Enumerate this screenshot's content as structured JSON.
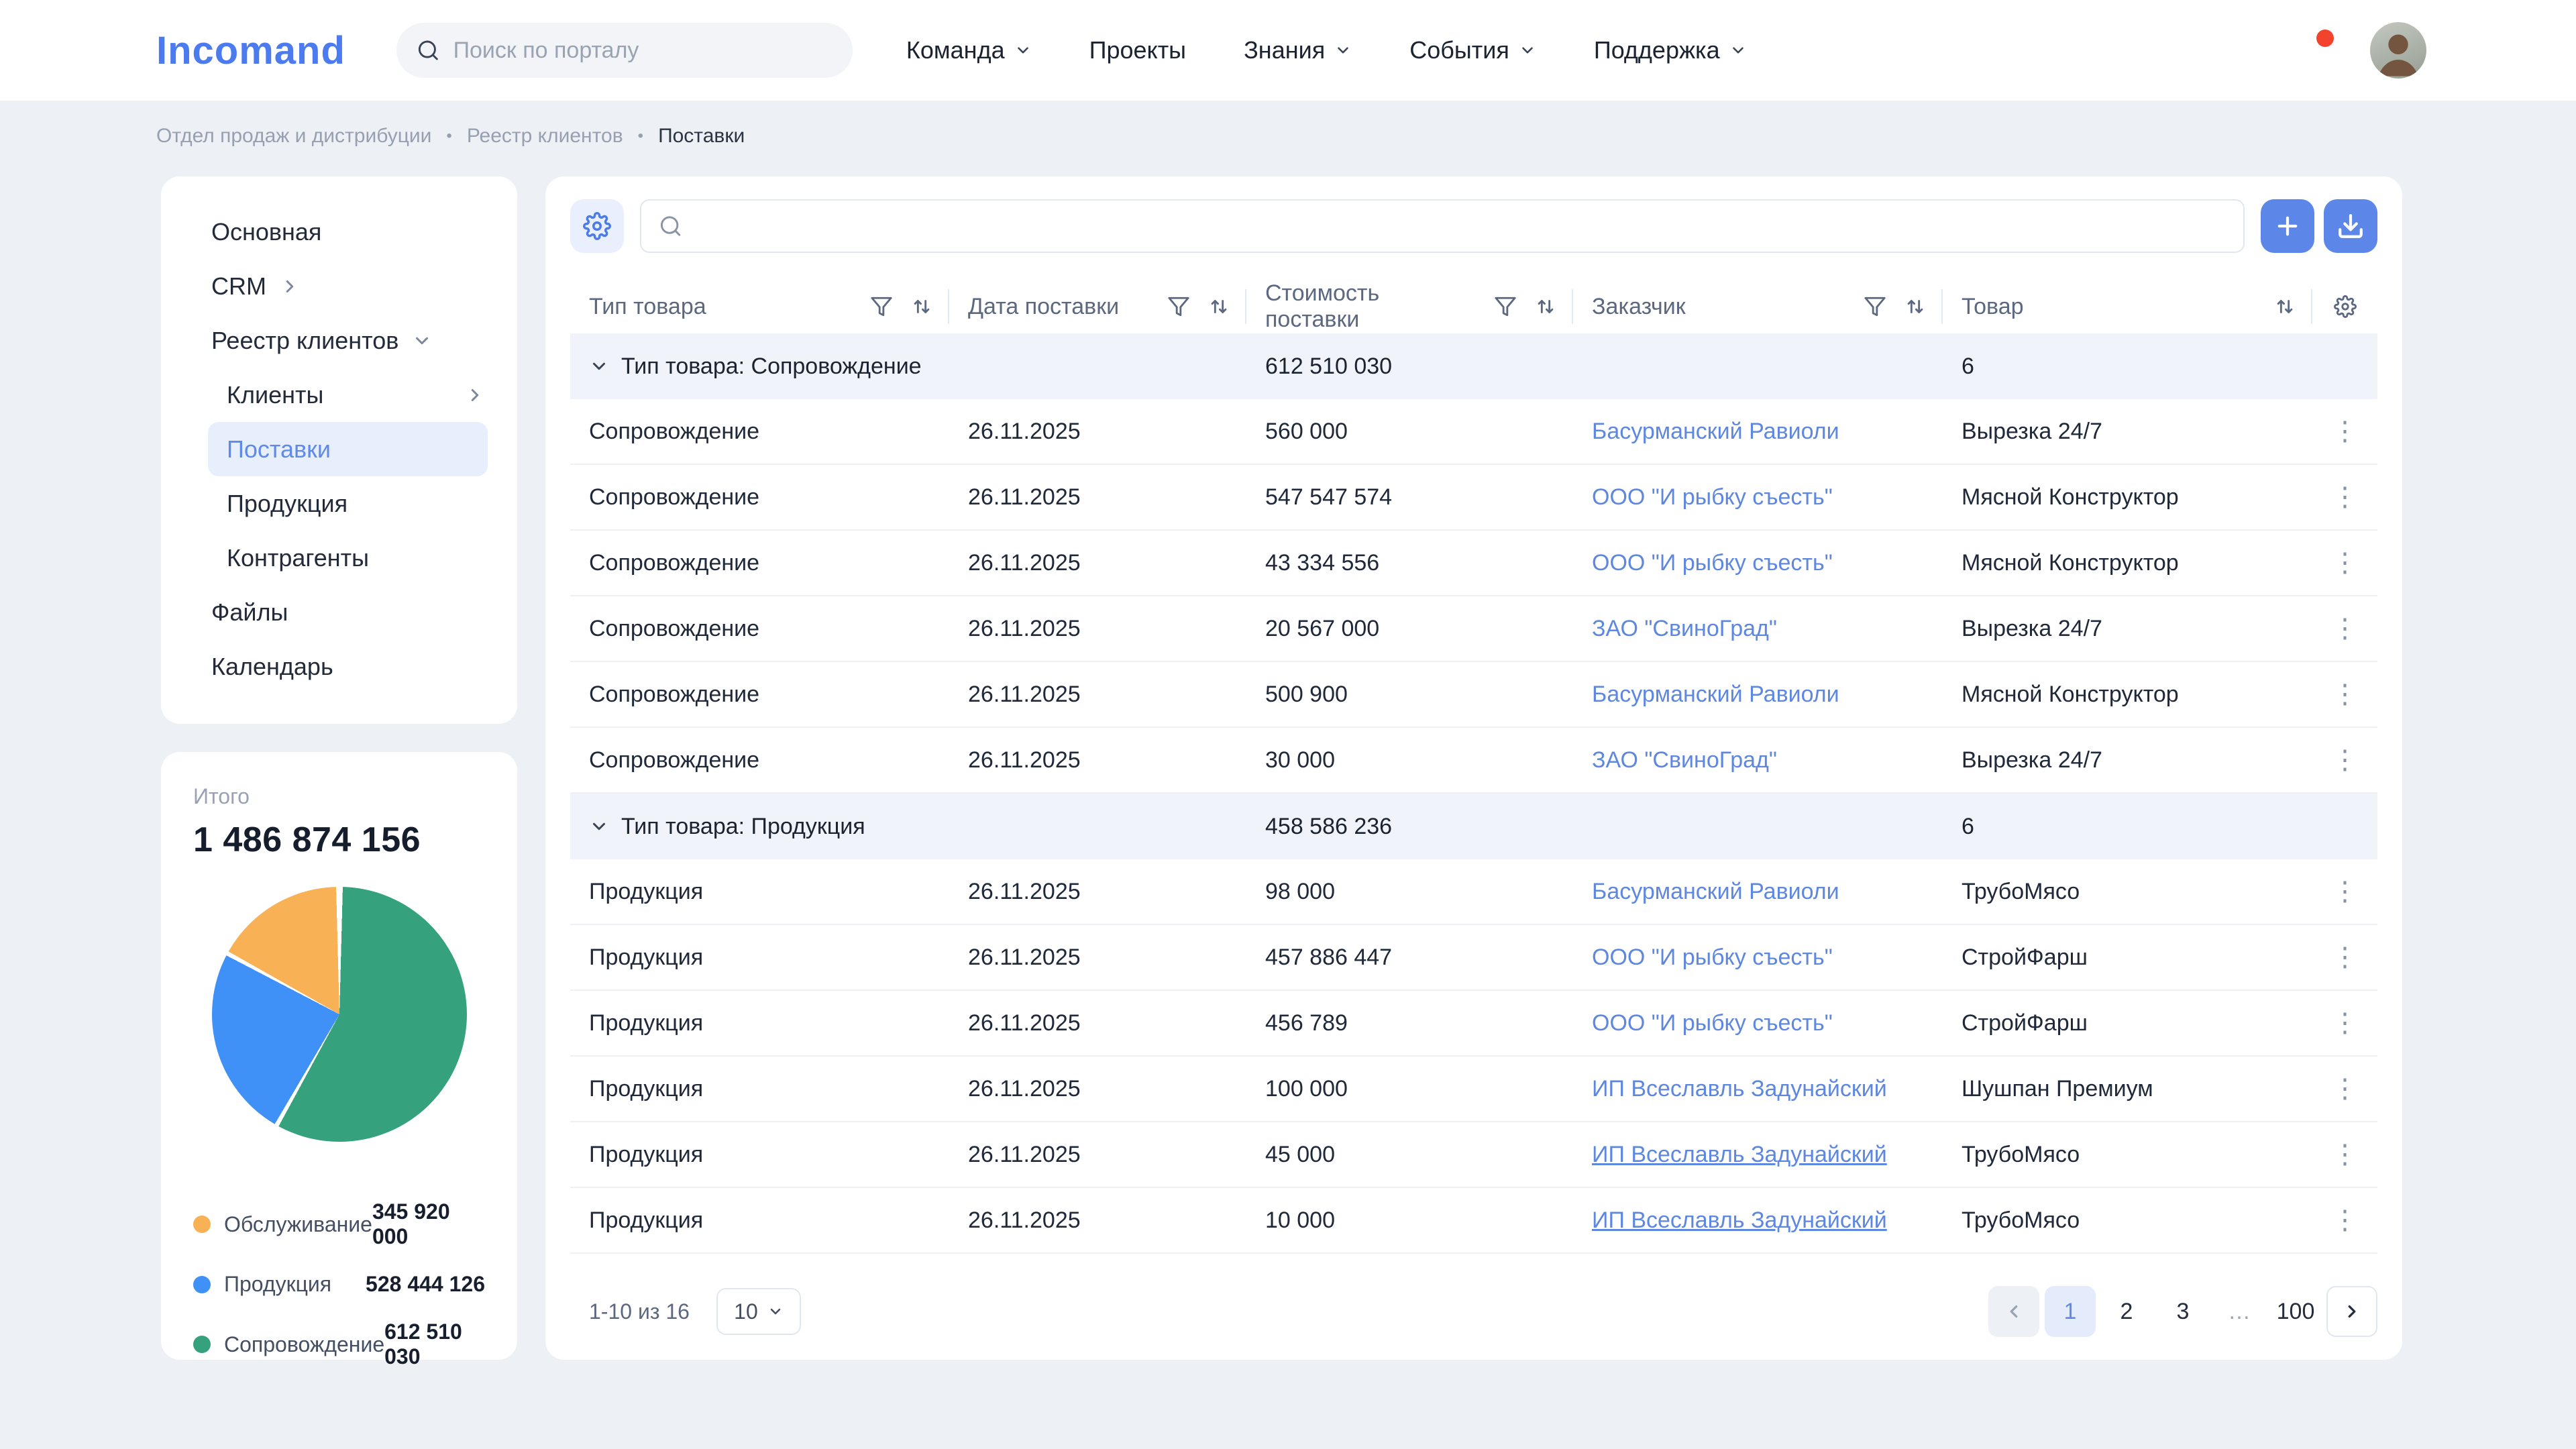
{
  "header": {
    "logo": "Incomand",
    "search_placeholder": "Поиск по порталу",
    "nav": [
      {
        "label": "Команда"
      },
      {
        "label": "Проекты"
      },
      {
        "label": "Знания"
      },
      {
        "label": "События"
      },
      {
        "label": "Поддержка"
      }
    ]
  },
  "breadcrumb": {
    "separator": "•",
    "items": [
      "Отдел продаж и дистрибуции",
      "Реестр клиентов",
      "Поставки"
    ]
  },
  "sidebar": {
    "items": [
      {
        "label": "Основная"
      },
      {
        "label": "CRM"
      },
      {
        "label": "Реестр клиентов"
      },
      {
        "label": "Клиенты"
      },
      {
        "label": "Поставки"
      },
      {
        "label": "Продукция"
      },
      {
        "label": "Контрагенты"
      },
      {
        "label": "Файлы"
      },
      {
        "label": "Календарь"
      }
    ]
  },
  "chart_data": {
    "type": "pie",
    "title": "Итого",
    "total": 1486874156,
    "total_display": "1 486 874 156",
    "legend_position": "bottom",
    "segments": [
      {
        "label": "Обслуживание",
        "value": 345920000,
        "display": "345 920 000",
        "color": "#F8B155"
      },
      {
        "label": "Продукция",
        "value": 528444126,
        "display": "528 444 126",
        "color": "#3F90F7"
      },
      {
        "label": "Сопровождение",
        "value": 612510030,
        "display": "612 510 030",
        "color": "#36A27D"
      }
    ],
    "render_segments": [
      {
        "label": "Сопровождение",
        "color": "#36A27D",
        "from": 1.5,
        "to": 208.5
      },
      {
        "label": "Продукция",
        "color": "#3F90F7",
        "from": 210.5,
        "to": 297.5
      },
      {
        "label": "Обслуживание",
        "color": "#F8B155",
        "from": 299.5,
        "to": 358.5
      }
    ]
  },
  "table": {
    "columns": [
      {
        "label": "Тип товара"
      },
      {
        "label": "Дата поставки"
      },
      {
        "label": "Стоимость поставки"
      },
      {
        "label": "Заказчик"
      },
      {
        "label": "Товар"
      }
    ],
    "groups": [
      {
        "title": "Тип товара: Сопровождение",
        "sum": "612 510 030",
        "count": "6",
        "rows": [
          {
            "type": "Сопровождение",
            "date": "26.11.2025",
            "cost": "560 000",
            "customer": "Басурманский Равиоли",
            "product": "Вырезка 24/7"
          },
          {
            "type": "Сопровождение",
            "date": "26.11.2025",
            "cost": "547 547 574",
            "customer": "ООО \"И рыбку съесть\"",
            "product": "Мясной Конструктор"
          },
          {
            "type": "Сопровождение",
            "date": "26.11.2025",
            "cost": "43 334 556",
            "customer": "ООО \"И рыбку съесть\"",
            "product": "Мясной Конструктор"
          },
          {
            "type": "Сопровождение",
            "date": "26.11.2025",
            "cost": "20 567 000",
            "customer": "ЗАО \"СвиноГрад\"",
            "product": "Вырезка 24/7"
          },
          {
            "type": "Сопровождение",
            "date": "26.11.2025",
            "cost": "500 900",
            "customer": "Басурманский Равиоли",
            "product": "Мясной Конструктор"
          },
          {
            "type": "Сопровождение",
            "date": "26.11.2025",
            "cost": "30 000",
            "customer": "ЗАО \"СвиноГрад\"",
            "product": "Вырезка 24/7"
          }
        ]
      },
      {
        "title": "Тип товара: Продукция",
        "sum": "458 586 236",
        "count": "6",
        "rows": [
          {
            "type": "Продукция",
            "date": "26.11.2025",
            "cost": "98 000",
            "customer": "Басурманский Равиоли",
            "product": "ТрубоМясо"
          },
          {
            "type": "Продукция",
            "date": "26.11.2025",
            "cost": "457 886 447",
            "customer": "ООО \"И рыбку съесть\"",
            "product": "СтройФарш"
          },
          {
            "type": "Продукция",
            "date": "26.11.2025",
            "cost": "456 789",
            "customer": "ООО \"И рыбку съесть\"",
            "product": "СтройФарш"
          },
          {
            "type": "Продукция",
            "date": "26.11.2025",
            "cost": "100 000",
            "customer": "ИП Всеславль Задунайский",
            "product": "Шушпан Премиум"
          },
          {
            "type": "Продукция",
            "date": "26.11.2025",
            "cost": "45 000",
            "customer": "ИП Всеславль Задунайский",
            "product": "ТрубоМясо"
          },
          {
            "type": "Продукция",
            "date": "26.11.2025",
            "cost": "10 000",
            "customer": "ИП Всеславль Задунайский",
            "product": "ТрубоМясо"
          }
        ]
      }
    ]
  },
  "pagination": {
    "range": "1-10 из 16",
    "page_size": "10",
    "pages": [
      "1",
      "2",
      "3",
      "…",
      "100"
    ],
    "active_page": "1"
  },
  "icons": {
    "kebab": "⋮"
  },
  "colors": {
    "accent_blue": "#5C87E9",
    "link_blue": "#5E87DF",
    "active_item": "#5F8AE7",
    "notification_red": "#F4432C",
    "page_bg": "#EDF0F5",
    "group_row_bg": "#F0F3F9"
  }
}
